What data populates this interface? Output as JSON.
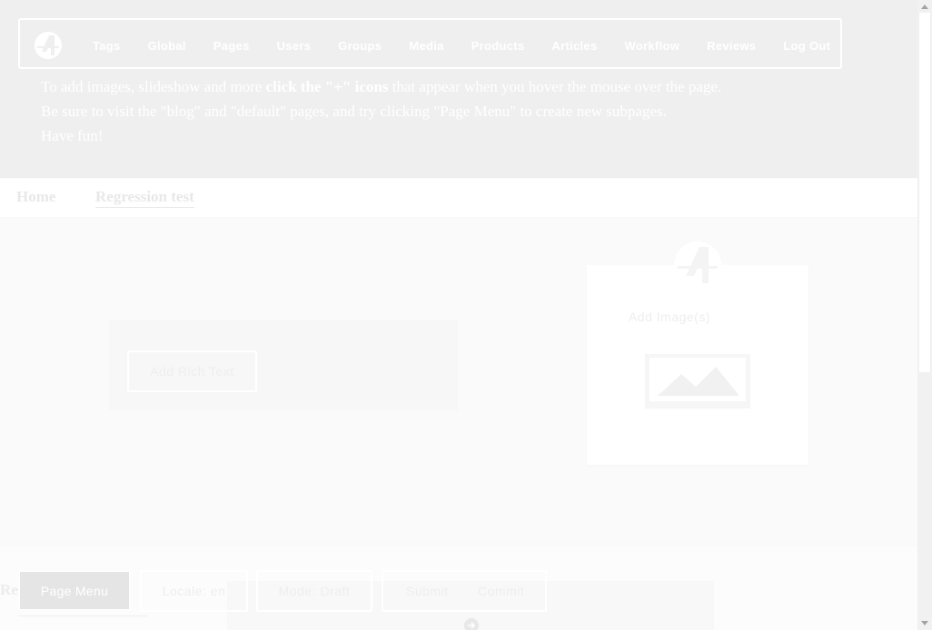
{
  "admin_bar": {
    "nav": [
      "Tags",
      "Global",
      "Pages",
      "Users",
      "Groups",
      "Media",
      "Products",
      "Articles",
      "Workflow",
      "Reviews",
      "Log Out"
    ]
  },
  "intro": {
    "line1_before": "To add images, slideshow and more ",
    "line1_bold": "click the \"+\" icons",
    "line1_after": " that appear when you hover the mouse over the page.",
    "line2": "Be sure to visit the \"blog\" and \"default\" pages, and try clicking \"Page Menu\" to create new subpages.",
    "line3": "Have fun!"
  },
  "breadcrumb": {
    "home": "Home",
    "current": "Regression test"
  },
  "content": {
    "add_rich_text": "Add Rich Text",
    "add_images": "Add Image(s)"
  },
  "bottom": {
    "partial_label": "Re",
    "page_menu": "Page Menu",
    "locale": "Locale: en",
    "mode": "Mode: Draft",
    "submit": "Submit",
    "commit": "Commit"
  },
  "colors": {
    "intro_bg": "#efefef",
    "text_white": "#ffffff",
    "page_menu_bg": "#e5e5e5",
    "content_bg": "#fafafa"
  },
  "icons": {
    "logo": "apostrophe-logo-icon",
    "placeholder": "image-placeholder-icon",
    "circle": "circle-arrow-icon"
  }
}
